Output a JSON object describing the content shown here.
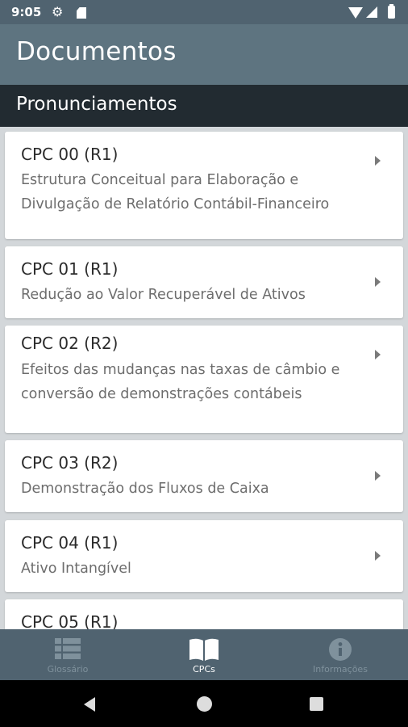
{
  "status_bar": {
    "time": "9:05",
    "icons": [
      "gear-icon",
      "sd-card-icon",
      "wifi-icon",
      "signal-icon",
      "battery-icon"
    ]
  },
  "app_bar": {
    "title": "Documentos"
  },
  "section": {
    "title": "Pronunciamentos"
  },
  "documents": [
    {
      "code": "CPC 00 (R1)",
      "desc": "Estrutura Conceitual para Elaboração e Divulgação de Relatório Contábil-Financeiro"
    },
    {
      "code": "CPC 01 (R1)",
      "desc": "Redução ao Valor Recuperável de Ativos"
    },
    {
      "code": "CPC 02 (R2)",
      "desc": "Efeitos das mudanças nas taxas de câmbio e conversão de demonstrações contábeis"
    },
    {
      "code": "CPC 03 (R2)",
      "desc": "Demonstração dos Fluxos de Caixa"
    },
    {
      "code": "CPC 04 (R1)",
      "desc": "Ativo Intangível"
    },
    {
      "code": "CPC 05 (R1)",
      "desc": ""
    }
  ],
  "bottom_nav": {
    "items": [
      {
        "label": "Glossário",
        "icon": "list-icon",
        "active": false
      },
      {
        "label": "CPCs",
        "icon": "book-icon",
        "active": true
      },
      {
        "label": "Informações",
        "icon": "info-icon",
        "active": false
      }
    ]
  },
  "colors": {
    "app_bar": "#5e7480",
    "section_header": "#222b31",
    "bottom_nav": "#506370",
    "background": "#d3d7da"
  }
}
